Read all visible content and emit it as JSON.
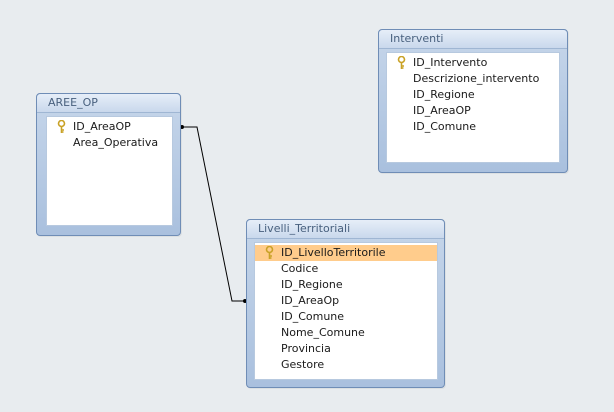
{
  "tables": {
    "aree_op": {
      "title": "AREE_OP",
      "fields": [
        {
          "name": "ID_AreaOP",
          "key": true
        },
        {
          "name": "Area_Operativa",
          "key": false
        }
      ]
    },
    "livelli_territoriali": {
      "title": "Livelli_Territoriali",
      "fields": [
        {
          "name": "ID_LivelloTerritorile",
          "key": true,
          "selected": true
        },
        {
          "name": "Codice",
          "key": false
        },
        {
          "name": "ID_Regione",
          "key": false
        },
        {
          "name": "ID_AreaOp",
          "key": false
        },
        {
          "name": "ID_Comune",
          "key": false
        },
        {
          "name": "Nome_Comune",
          "key": false
        },
        {
          "name": "Provincia",
          "key": false
        },
        {
          "name": "Gestore",
          "key": false
        }
      ]
    },
    "interventi": {
      "title": "Interventi",
      "fields": [
        {
          "name": "ID_Intervento",
          "key": true
        },
        {
          "name": "Descrizione_intervento",
          "key": false
        },
        {
          "name": "ID_Regione",
          "key": false
        },
        {
          "name": "ID_AreaOP",
          "key": false
        },
        {
          "name": "ID_Comune",
          "key": false
        }
      ]
    }
  },
  "colors": {
    "canvas": "#e8ecef",
    "window_frame": "#a9c0de",
    "selected_field": "#ffcc8c",
    "key_icon": "#c9a227",
    "relation_line": "#000000"
  },
  "icons": {
    "primary_key": "key-icon"
  }
}
